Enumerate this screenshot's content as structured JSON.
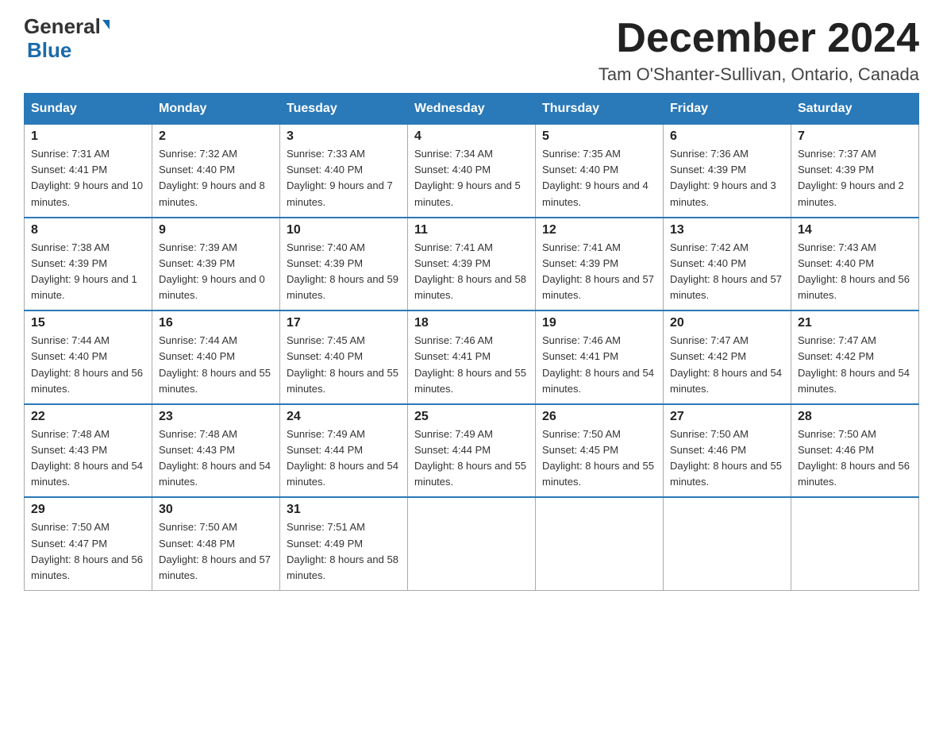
{
  "header": {
    "logo_general": "General",
    "logo_blue": "Blue",
    "month_title": "December 2024",
    "location": "Tam O'Shanter-Sullivan, Ontario, Canada"
  },
  "weekdays": [
    "Sunday",
    "Monday",
    "Tuesday",
    "Wednesday",
    "Thursday",
    "Friday",
    "Saturday"
  ],
  "weeks": [
    [
      {
        "day": "1",
        "sunrise": "7:31 AM",
        "sunset": "4:41 PM",
        "daylight": "9 hours and 10 minutes."
      },
      {
        "day": "2",
        "sunrise": "7:32 AM",
        "sunset": "4:40 PM",
        "daylight": "9 hours and 8 minutes."
      },
      {
        "day": "3",
        "sunrise": "7:33 AM",
        "sunset": "4:40 PM",
        "daylight": "9 hours and 7 minutes."
      },
      {
        "day": "4",
        "sunrise": "7:34 AM",
        "sunset": "4:40 PM",
        "daylight": "9 hours and 5 minutes."
      },
      {
        "day": "5",
        "sunrise": "7:35 AM",
        "sunset": "4:40 PM",
        "daylight": "9 hours and 4 minutes."
      },
      {
        "day": "6",
        "sunrise": "7:36 AM",
        "sunset": "4:39 PM",
        "daylight": "9 hours and 3 minutes."
      },
      {
        "day": "7",
        "sunrise": "7:37 AM",
        "sunset": "4:39 PM",
        "daylight": "9 hours and 2 minutes."
      }
    ],
    [
      {
        "day": "8",
        "sunrise": "7:38 AM",
        "sunset": "4:39 PM",
        "daylight": "9 hours and 1 minute."
      },
      {
        "day": "9",
        "sunrise": "7:39 AM",
        "sunset": "4:39 PM",
        "daylight": "9 hours and 0 minutes."
      },
      {
        "day": "10",
        "sunrise": "7:40 AM",
        "sunset": "4:39 PM",
        "daylight": "8 hours and 59 minutes."
      },
      {
        "day": "11",
        "sunrise": "7:41 AM",
        "sunset": "4:39 PM",
        "daylight": "8 hours and 58 minutes."
      },
      {
        "day": "12",
        "sunrise": "7:41 AM",
        "sunset": "4:39 PM",
        "daylight": "8 hours and 57 minutes."
      },
      {
        "day": "13",
        "sunrise": "7:42 AM",
        "sunset": "4:40 PM",
        "daylight": "8 hours and 57 minutes."
      },
      {
        "day": "14",
        "sunrise": "7:43 AM",
        "sunset": "4:40 PM",
        "daylight": "8 hours and 56 minutes."
      }
    ],
    [
      {
        "day": "15",
        "sunrise": "7:44 AM",
        "sunset": "4:40 PM",
        "daylight": "8 hours and 56 minutes."
      },
      {
        "day": "16",
        "sunrise": "7:44 AM",
        "sunset": "4:40 PM",
        "daylight": "8 hours and 55 minutes."
      },
      {
        "day": "17",
        "sunrise": "7:45 AM",
        "sunset": "4:40 PM",
        "daylight": "8 hours and 55 minutes."
      },
      {
        "day": "18",
        "sunrise": "7:46 AM",
        "sunset": "4:41 PM",
        "daylight": "8 hours and 55 minutes."
      },
      {
        "day": "19",
        "sunrise": "7:46 AM",
        "sunset": "4:41 PM",
        "daylight": "8 hours and 54 minutes."
      },
      {
        "day": "20",
        "sunrise": "7:47 AM",
        "sunset": "4:42 PM",
        "daylight": "8 hours and 54 minutes."
      },
      {
        "day": "21",
        "sunrise": "7:47 AM",
        "sunset": "4:42 PM",
        "daylight": "8 hours and 54 minutes."
      }
    ],
    [
      {
        "day": "22",
        "sunrise": "7:48 AM",
        "sunset": "4:43 PM",
        "daylight": "8 hours and 54 minutes."
      },
      {
        "day": "23",
        "sunrise": "7:48 AM",
        "sunset": "4:43 PM",
        "daylight": "8 hours and 54 minutes."
      },
      {
        "day": "24",
        "sunrise": "7:49 AM",
        "sunset": "4:44 PM",
        "daylight": "8 hours and 54 minutes."
      },
      {
        "day": "25",
        "sunrise": "7:49 AM",
        "sunset": "4:44 PM",
        "daylight": "8 hours and 55 minutes."
      },
      {
        "day": "26",
        "sunrise": "7:50 AM",
        "sunset": "4:45 PM",
        "daylight": "8 hours and 55 minutes."
      },
      {
        "day": "27",
        "sunrise": "7:50 AM",
        "sunset": "4:46 PM",
        "daylight": "8 hours and 55 minutes."
      },
      {
        "day": "28",
        "sunrise": "7:50 AM",
        "sunset": "4:46 PM",
        "daylight": "8 hours and 56 minutes."
      }
    ],
    [
      {
        "day": "29",
        "sunrise": "7:50 AM",
        "sunset": "4:47 PM",
        "daylight": "8 hours and 56 minutes."
      },
      {
        "day": "30",
        "sunrise": "7:50 AM",
        "sunset": "4:48 PM",
        "daylight": "8 hours and 57 minutes."
      },
      {
        "day": "31",
        "sunrise": "7:51 AM",
        "sunset": "4:49 PM",
        "daylight": "8 hours and 58 minutes."
      },
      null,
      null,
      null,
      null
    ]
  ]
}
